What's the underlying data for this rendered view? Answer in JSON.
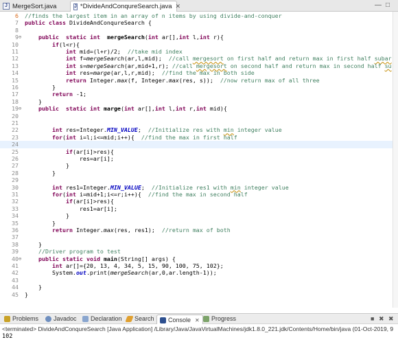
{
  "tabs": [
    {
      "label": "MergeSort.java",
      "active": false
    },
    {
      "label": "*DivideAndConqureSearch.java",
      "active": true
    }
  ],
  "window_controls": {
    "minimize": "—",
    "maximize": "□"
  },
  "code_lines": [
    {
      "n": "6",
      "text": "//finds the largest item in an array of n items by using divide-and-conquer"
    },
    {
      "n": "7",
      "text": "public class DivideAndConqureSearch {"
    },
    {
      "n": "8",
      "text": ""
    },
    {
      "n": "9",
      "text": "    public  static int  mergeSearch(int ar[],int l,int r){"
    },
    {
      "n": "10",
      "text": "        if(l<r){"
    },
    {
      "n": "11",
      "text": "            int mid=(l+r)/2;  //take mid index"
    },
    {
      "n": "12",
      "text": "            int f=mergeSearch(ar,l,mid);  //call mergesort on first half and return max in first half subar"
    },
    {
      "n": "13",
      "text": "            int s=mergeSearch(ar,mid+1,r); //call mergesort on second half and return max in second half su"
    },
    {
      "n": "14",
      "text": "            int res=marge(ar,l,r,mid);  //find the max in both side"
    },
    {
      "n": "15",
      "text": "            return Integer.max(f, Integer.max(res, s));  //now return max of all three"
    },
    {
      "n": "16",
      "text": "        }"
    },
    {
      "n": "17",
      "text": "        return -1;"
    },
    {
      "n": "18",
      "text": "    }"
    },
    {
      "n": "19",
      "text": "    public  static int marge(int ar[],int l,int r,int mid){"
    },
    {
      "n": "20",
      "text": ""
    },
    {
      "n": "21",
      "text": ""
    },
    {
      "n": "22",
      "text": "        int res=Integer.MIN_VALUE;  //Initialize res with min integer value"
    },
    {
      "n": "23",
      "text": "        for(int i=l;i<=mid;i++){  //find the max in first half"
    },
    {
      "n": "24",
      "text": ""
    },
    {
      "n": "25",
      "text": "            if(ar[i]>res){"
    },
    {
      "n": "26",
      "text": "                res=ar[i];"
    },
    {
      "n": "27",
      "text": "            }"
    },
    {
      "n": "28",
      "text": "        }"
    },
    {
      "n": "29",
      "text": ""
    },
    {
      "n": "30",
      "text": "        int res1=Integer.MIN_VALUE;  //Initialize res1 with min integer value"
    },
    {
      "n": "31",
      "text": "        for(int i=mid+1;i<=r;i++){  //find the max in second half"
    },
    {
      "n": "32",
      "text": "            if(ar[i]>res){"
    },
    {
      "n": "33",
      "text": "                res1=ar[i];"
    },
    {
      "n": "34",
      "text": "            }"
    },
    {
      "n": "35",
      "text": "        }"
    },
    {
      "n": "36",
      "text": "        return Integer.max(res, res1);  //return max of both"
    },
    {
      "n": "37",
      "text": ""
    },
    {
      "n": "38",
      "text": "    }"
    },
    {
      "n": "39",
      "text": "    //Driver program to test"
    },
    {
      "n": "40",
      "text": "    public static void main(String[] args) {"
    },
    {
      "n": "41",
      "text": "        int ar[]={20, 13, 4, 34, 5, 15, 90, 100, 75, 102};"
    },
    {
      "n": "42",
      "text": "        System.out.print(mergeSearch(ar,0,ar.length-1));"
    },
    {
      "n": "43",
      "text": ""
    },
    {
      "n": "44",
      "text": "    }"
    },
    {
      "n": "45",
      "text": "}"
    }
  ],
  "views": {
    "tabs": [
      "Problems",
      "Javadoc",
      "Declaration",
      "Search",
      "Console",
      "Progress"
    ],
    "active": "Console"
  },
  "console": {
    "header": "<terminated> DivideAndConqureSearch [Java Application] /Library/Java/JavaVirtualMachines/jdk1.8.0_221.jdk/Contents/Home/bin/java (01-Oct-2019, 9",
    "output": "102"
  },
  "colors": {
    "keyword": "#7f0055",
    "comment": "#3f7f5f",
    "field": "#0000c0",
    "highlight": "#e8f2fe"
  }
}
